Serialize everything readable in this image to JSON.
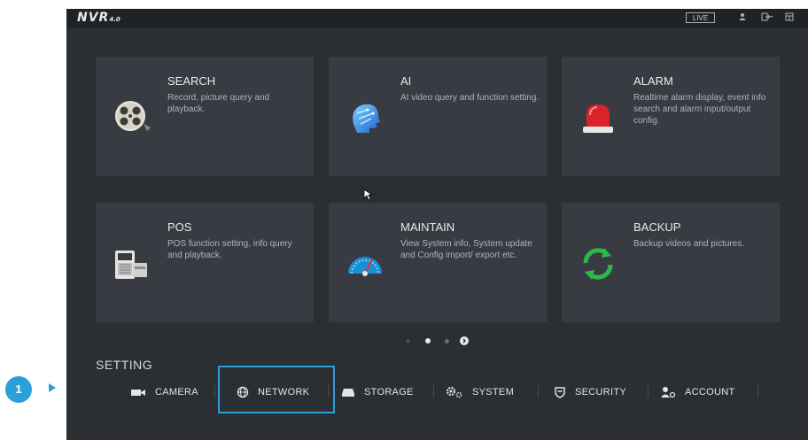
{
  "topbar": {
    "logo_main": "NVR",
    "logo_version": "4.0",
    "live_label": "LIVE",
    "icons": [
      "user-icon",
      "logout-icon",
      "window-icon"
    ]
  },
  "cards": [
    {
      "title": "SEARCH",
      "desc": "Record, picture query and playback.",
      "icon": "film-reel-icon"
    },
    {
      "title": "AI",
      "desc": "AI video query and function setting.",
      "icon": "ai-head-icon"
    },
    {
      "title": "ALARM",
      "desc": "Realtime alarm display, event info search and alarm input/output config.",
      "icon": "alarm-light-icon"
    },
    {
      "title": "POS",
      "desc": "POS function setting, info query and playback.",
      "icon": "pos-terminal-icon"
    },
    {
      "title": "MAINTAIN",
      "desc": "View System info, System update and Config import/ export etc.",
      "icon": "gauge-icon"
    },
    {
      "title": "BACKUP",
      "desc": "Backup videos and pictures.",
      "icon": "refresh-icon"
    }
  ],
  "pagination": {
    "pages": 3,
    "active": 1
  },
  "setting": {
    "label": "SETTING",
    "items": [
      {
        "label": "CAMERA",
        "icon": "camera-icon"
      },
      {
        "label": "NETWORK",
        "icon": "globe-icon"
      },
      {
        "label": "STORAGE",
        "icon": "hdd-icon"
      },
      {
        "label": "SYSTEM",
        "icon": "gears-icon"
      },
      {
        "label": "SECURITY",
        "icon": "shield-icon"
      },
      {
        "label": "ACCOUNT",
        "icon": "account-icon"
      }
    ]
  },
  "annotation": {
    "step": "1"
  },
  "colors": {
    "accent": "#2b9fd8",
    "background": "#2b2e33",
    "card": "#383c42"
  }
}
